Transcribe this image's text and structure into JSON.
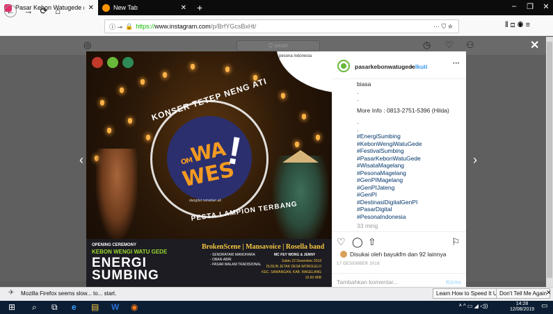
{
  "browser": {
    "tabs": [
      {
        "title": "Pasar Kebon Watugede (@pasa",
        "active": true,
        "favicon_color": "#e1306c"
      },
      {
        "title": "New Tab",
        "active": false,
        "favicon_color": "#ff9500"
      }
    ],
    "new_tab_symbol": "+",
    "tab_close": "✕",
    "window": {
      "minimize": "–",
      "maximize": "❐",
      "close": "✕"
    },
    "url": {
      "scheme": "https://",
      "host": "www.instagram.com",
      "path": "/p/BrfYGcsBxHt/"
    },
    "url_info": "ⓘ ⊸",
    "url_menu": "··· ⛉ ☆",
    "nav": {
      "back": "←",
      "forward": "→",
      "reload": "⟳",
      "home": "⌂"
    },
    "right_icons": "⫴  ⊡  ◉  ≡"
  },
  "instagram": {
    "header": {
      "search_placeholder": "Q pasar",
      "logo_icon": "◎",
      "compass_icon": "◷",
      "heart_icon": "♡",
      "user_icon": "⚇"
    },
    "close": "✕",
    "prev_arrow": "‹",
    "next_arrow": "›"
  },
  "poster": {
    "pesona_text": "pesona indonesia",
    "arc_top": "KONSER TETEP NENG ATI",
    "om": "OM",
    "wa": "WA",
    "wes": "WES",
    "excl": "!",
    "dangdut": "dangdut romahan ati",
    "arc_bottom": "PESTA LAMPION TERBANG",
    "opening": "OPENING CEREMONY",
    "kebon": "KEBON WENGI WATU GEDE",
    "energi": "ENERGI",
    "sumbing": "SUMBING",
    "bands": "BrokenScene | Mansavoice | Rosella band",
    "mc": "MC FEY WONG & JENNY",
    "acts": [
      "- SENDRATARI MANOHARA",
      "- OBAR-ABIR",
      "- PASAR MALAM TRADISIONAL"
    ],
    "schedule": [
      "Sabtu 22 Desember 2018",
      "DUSUN JETAK DESA WONOLELO",
      "KEC. SAWANGAN, KAB. MAGELANG",
      "19.00 WIB"
    ]
  },
  "post": {
    "username": "pasarkebonwatugede",
    "dot": "•",
    "follow": "Ikuti",
    "menu": "···",
    "caption_lines": [
      "biasa",
      ".",
      ".",
      "More Info : 0813-2751-5396 (Hilda)",
      ".",
      "."
    ],
    "hashtags": [
      "#EnergiSumbing",
      "#KebonWengiWatuGede",
      "#FestivalSumbing",
      "#PasarKebonWatuGede",
      "#WisataMagelang",
      "#PesonaMagelang",
      "#GenPIMagelang",
      "#GenPIJateng",
      "#GenPI",
      "#DestinasiDigitalGenPI",
      "#PasarDigital",
      "#PesonaIndonesia"
    ],
    "time_ago": "33 ming",
    "like_icon": "♡",
    "comment_icon": "◯",
    "share_icon": "⇧",
    "save_icon": "⚐",
    "liked_by": "Disukai oleh bayukfm dan 92 lainnya",
    "date": "17 DESEMBER 2018",
    "comment_placeholder": "Tambahkan komentar...",
    "comment_post": "Kirim"
  },
  "notification": {
    "icon": "✈",
    "message": "Mozilla Firefox seems slow... to... start.",
    "learn_btn": "Learn How to Speed It Up",
    "dismiss_btn": "Don't Tell Me Again",
    "close": "✕"
  },
  "taskbar": {
    "icons": [
      "⊞",
      "⌕",
      "⧉",
      "e",
      "▤",
      "W",
      "◉"
    ],
    "tray": "ᴬ ^ ▭ ◢ ◁)) ",
    "time": "14:28",
    "date": "12/08/2019",
    "notif_icon": "▭"
  }
}
